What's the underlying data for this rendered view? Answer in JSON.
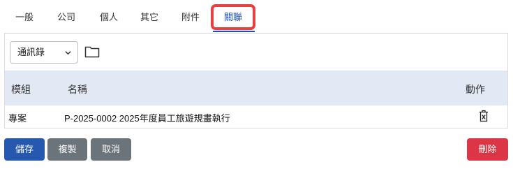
{
  "tabs": [
    "一般",
    "公司",
    "個人",
    "其它",
    "附件"
  ],
  "active_tab": "關聯",
  "toolbar": {
    "select_value": "通訊錄"
  },
  "table": {
    "headers": {
      "module": "模組",
      "name": "名稱",
      "action": "動作"
    },
    "rows": [
      {
        "module": "專案",
        "name": "P-2025-0002 2025年度員工旅遊規畫執行"
      }
    ]
  },
  "buttons": {
    "save": "儲存",
    "copy": "複製",
    "cancel": "取消",
    "delete": "刪除"
  },
  "colors": {
    "accent": "#2758b0",
    "danger": "#dc3545",
    "secondary": "#6b737b",
    "highlight": "#e8403f"
  }
}
